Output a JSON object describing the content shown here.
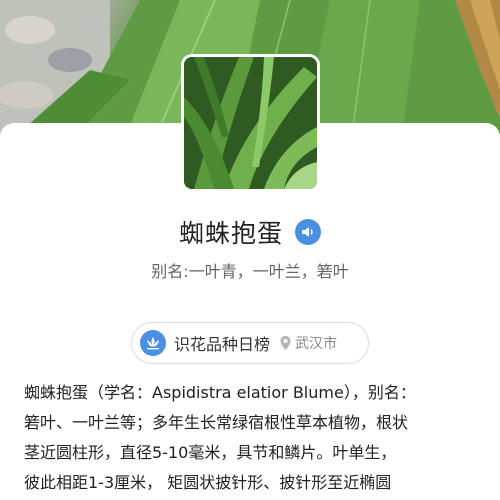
{
  "plant": {
    "name": "蜘蛛抱蛋",
    "alias": "别名:一叶青，一叶兰，箬叶"
  },
  "tag": {
    "label": "识花品种日榜",
    "city": "武汉市",
    "icon": "lotus-icon"
  },
  "description": {
    "lines": [
      "蜘蛛抱蛋（学名：Aspidistra elatior Blume），别名：",
      "箬叶、一叶兰等；多年生长常绿宿根性草本植物，根状",
      "茎近圆柱形，直径5-10毫米，具节和鳞片。叶单生，",
      "彼此相距1-3厘米，  矩圆状披针形、披针形至近椭圆"
    ]
  },
  "icons": {
    "sound": "speaker-icon",
    "location": "location-pin-icon"
  },
  "colors": {
    "accent": "#4a90e2",
    "text": "#222222",
    "muted": "#666666"
  }
}
